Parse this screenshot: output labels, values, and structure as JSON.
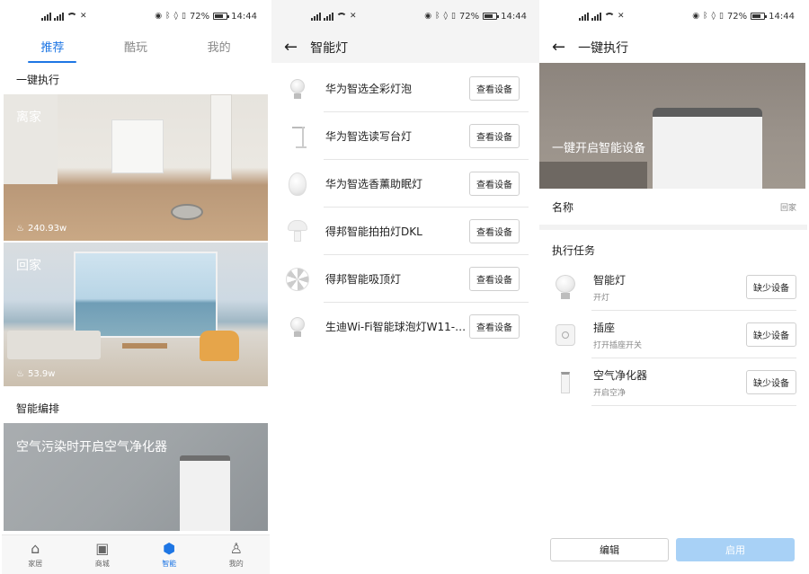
{
  "status": {
    "battery": "72%",
    "time": "14:44"
  },
  "screen1": {
    "tabs": [
      "推荐",
      "酷玩",
      "我的"
    ],
    "section1_title": "一键执行",
    "card_leave": {
      "title": "离家",
      "stat": "240.93w"
    },
    "card_home": {
      "title": "回家",
      "stat": "53.9w"
    },
    "section2_title": "智能编排",
    "card_air": {
      "title": "空气污染时开启空气净化器"
    },
    "nav": [
      "家居",
      "商城",
      "智能",
      "我的"
    ]
  },
  "screen2": {
    "title": "智能灯",
    "button_label": "查看设备",
    "devices": [
      "华为智选全彩灯泡",
      "华为智选读写台灯",
      "华为智选香薰助眠灯",
      "得邦智能拍拍灯DKL",
      "得邦智能吸顶灯",
      "生迪Wi-Fi智能球泡灯W11-C..."
    ]
  },
  "screen3": {
    "title": "一键执行",
    "hero_title": "一键开启智能设备",
    "name_label": "名称",
    "name_value": "回家",
    "tasks_title": "执行任务",
    "missing_label": "缺少设备",
    "tasks": [
      {
        "name": "智能灯",
        "desc": "开灯"
      },
      {
        "name": "插座",
        "desc": "打开插座开关"
      },
      {
        "name": "空气净化器",
        "desc": "开启空净"
      }
    ],
    "edit_label": "编辑",
    "enable_label": "启用"
  }
}
